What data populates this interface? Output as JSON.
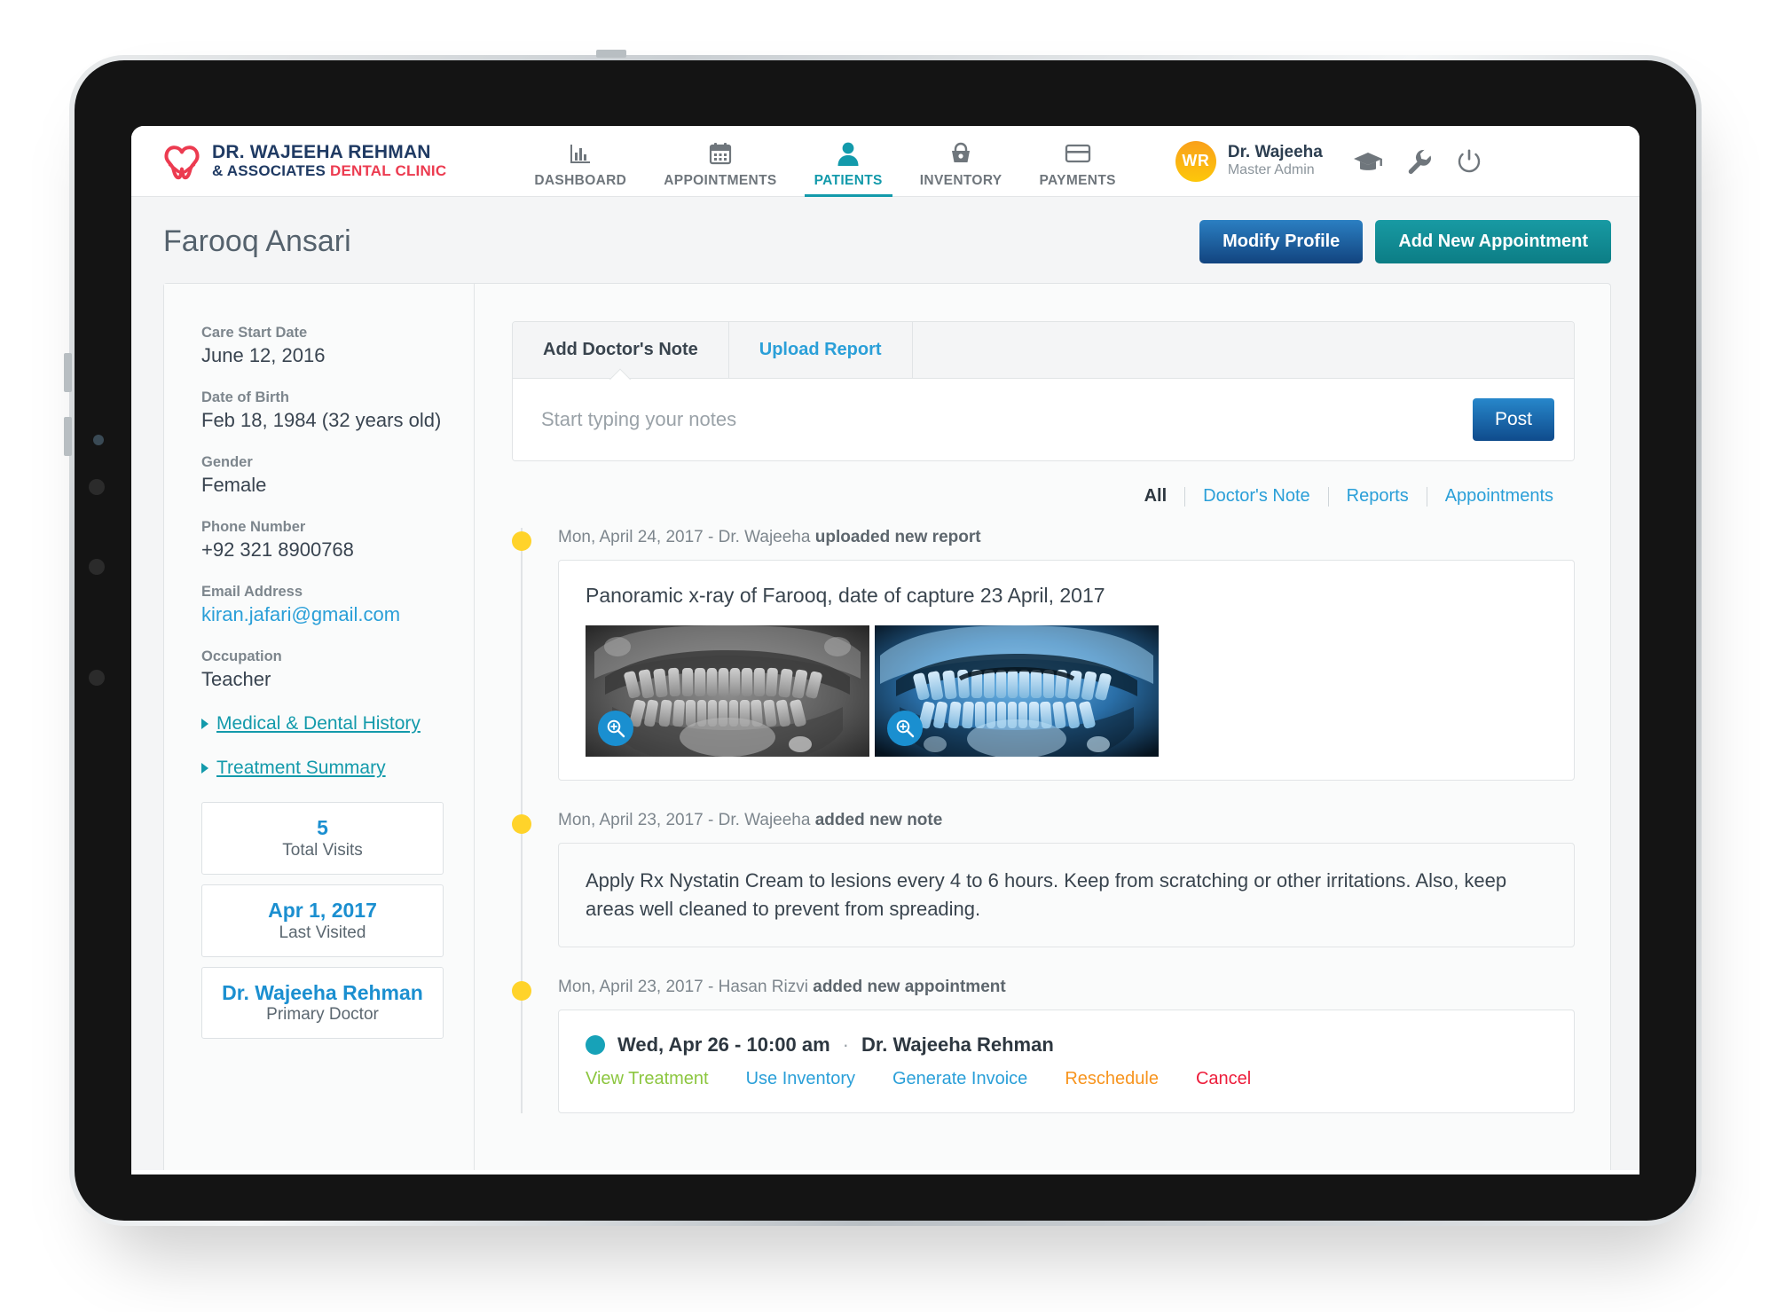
{
  "brand": {
    "line1": "DR. WAJEEHA REHMAN",
    "line2_dark": "& ASSOCIATES",
    "line2_red": "DENTAL CLINIC"
  },
  "nav": {
    "items": [
      {
        "label": "DASHBOARD",
        "icon": "bar-chart-icon",
        "active": false
      },
      {
        "label": "APPOINTMENTS",
        "icon": "calendar-icon",
        "active": false
      },
      {
        "label": "PATIENTS",
        "icon": "person-icon",
        "active": true
      },
      {
        "label": "INVENTORY",
        "icon": "basket-icon",
        "active": false
      },
      {
        "label": "PAYMENTS",
        "icon": "credit-card-icon",
        "active": false
      }
    ]
  },
  "user": {
    "initials": "WR",
    "name": "Dr. Wajeeha",
    "role": "Master Admin"
  },
  "header_icons": [
    "graduation-cap-icon",
    "wrench-icon",
    "power-icon"
  ],
  "page": {
    "title": "Farooq Ansari",
    "modify_profile_label": "Modify Profile",
    "add_appointment_label": "Add New Appointment"
  },
  "sidebar": {
    "fields": [
      {
        "label": "Care Start Date",
        "value": "June 12, 2016",
        "link": false
      },
      {
        "label": "Date of Birth",
        "value": "Feb 18, 1984 (32 years old)",
        "link": false
      },
      {
        "label": "Gender",
        "value": "Female",
        "link": false
      },
      {
        "label": "Phone Number",
        "value": "+92 321 8900768",
        "link": false
      },
      {
        "label": "Email Address",
        "value": "kiran.jafari@gmail.com",
        "link": true
      },
      {
        "label": "Occupation",
        "value": "Teacher",
        "link": false
      }
    ],
    "disclosures": [
      {
        "label": "Medical & Dental History"
      },
      {
        "label": "Treatment Summary"
      }
    ],
    "stats": [
      {
        "value": "5",
        "label": "Total Visits"
      },
      {
        "value": "Apr 1, 2017",
        "label": "Last Visited"
      },
      {
        "value": "Dr. Wajeeha Rehman",
        "label": "Primary Doctor"
      }
    ]
  },
  "composer": {
    "tabs": [
      {
        "label": "Add Doctor's Note",
        "active": true
      },
      {
        "label": "Upload Report",
        "active": false
      }
    ],
    "placeholder": "Start typing your notes",
    "value": "",
    "post_label": "Post"
  },
  "filters": [
    {
      "label": "All",
      "active": true
    },
    {
      "label": "Doctor's Note",
      "active": false
    },
    {
      "label": "Reports",
      "active": false
    },
    {
      "label": "Appointments",
      "active": false
    }
  ],
  "timeline": [
    {
      "type": "report",
      "meta_plain": "Mon, April 24, 2017 - Dr. Wajeeha ",
      "meta_bold": "uploaded new report",
      "report_title": "Panoramic x-ray of Farooq, date of capture 23 April, 2017",
      "images": [
        {
          "name": "panoramic-xray-grayscale",
          "zoom_icon": "magnifier-plus-icon"
        },
        {
          "name": "panoramic-xray-blue",
          "zoom_icon": "magnifier-plus-icon"
        }
      ]
    },
    {
      "type": "note",
      "meta_plain": "Mon, April 23, 2017 - Dr. Wajeeha ",
      "meta_bold": "added new note",
      "note_text": "Apply Rx Nystatin Cream to lesions every 4 to 6 hours. Keep from scratching or other irritations. Also, keep areas well cleaned to prevent from spreading."
    },
    {
      "type": "appointment",
      "meta_plain": "Mon, April 23, 2017 - Hasan Rizvi ",
      "meta_bold": "added new appointment",
      "when": "Wed, Apr 26 - 10:00 am",
      "separator": "·",
      "doctor": "Dr. Wajeeha Rehman",
      "actions": [
        {
          "label": "View Treatment",
          "color": "#8cc63f"
        },
        {
          "label": "Use Inventory",
          "color": "#2a9fd8"
        },
        {
          "label": "Generate Invoice",
          "color": "#2a9fd8"
        },
        {
          "label": "Reschedule",
          "color": "#f7941e"
        },
        {
          "label": "Cancel",
          "color": "#ed1c3a"
        }
      ]
    }
  ],
  "colors": {
    "accent_teal": "#139aab",
    "accent_blue": "#2a9fd8",
    "brand_red": "#ec3b50",
    "brand_navy": "#1f3a63",
    "timeline_dot": "#ffd32a",
    "avatar_orange": "#f9a01b"
  }
}
